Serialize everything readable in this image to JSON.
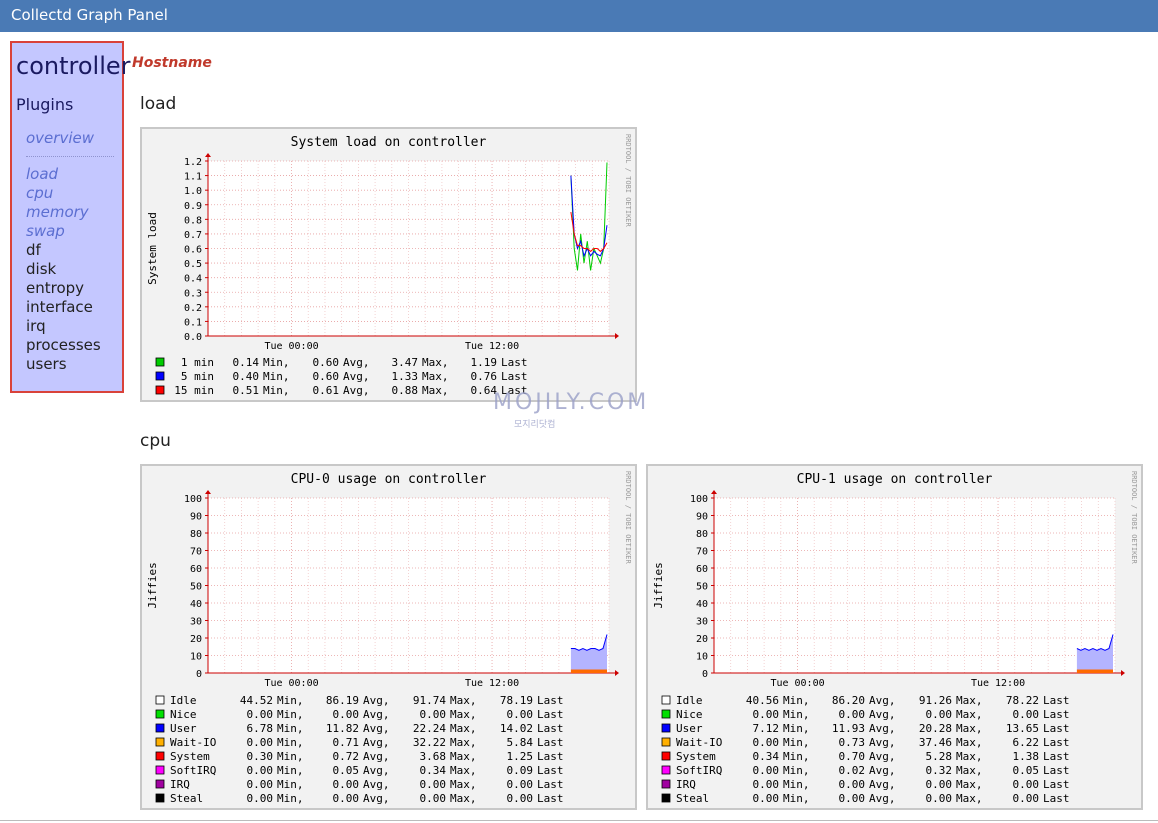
{
  "app": {
    "title": "Collectd Graph Panel"
  },
  "sidebar": {
    "host": "controller",
    "plugins_heading": "Plugins",
    "overview": "overview",
    "links": [
      "load",
      "cpu",
      "memory",
      "swap"
    ],
    "items": [
      "df",
      "disk",
      "entropy",
      "interface",
      "irq",
      "processes",
      "users"
    ]
  },
  "main": {
    "hostname_label": "Hostname",
    "sections": {
      "load": "load",
      "cpu": "cpu"
    }
  },
  "watermark": {
    "text": "MOJILY.COM",
    "sub": "모지리닷컴"
  },
  "colors": {
    "topbar": "#4a7ab5",
    "sidebar": "#c4c7ff",
    "highlight_border": "#d9423a",
    "hostname": "#c0392b"
  },
  "graphs": [
    {
      "id": "load",
      "title": "System load on controller",
      "ylabel": "System load",
      "side_label": "RRDTOOL / TOBI OETIKER",
      "x_ticks": [
        "Tue 00:00",
        "Tue 12:00"
      ],
      "y_ticks": [
        "0.0",
        "0.1",
        "0.2",
        "0.3",
        "0.4",
        "0.5",
        "0.6",
        "0.7",
        "0.8",
        "0.9",
        "1.0",
        "1.1",
        "1.2"
      ],
      "legend": [
        {
          "name": "1 min",
          "min": "0.14",
          "avg": "0.60",
          "max": "3.47",
          "last": "1.19",
          "color": "#00cc00"
        },
        {
          "name": "5 min",
          "min": "0.40",
          "avg": "0.60",
          "max": "1.33",
          "last": "0.76",
          "color": "#0000ff"
        },
        {
          "name": "15 min",
          "min": "0.51",
          "avg": "0.61",
          "max": "0.88",
          "last": "0.64",
          "color": "#ff0000"
        }
      ]
    },
    {
      "id": "cpu0",
      "title": "CPU-0 usage on controller",
      "ylabel": "Jiffies",
      "side_label": "RRDTOOL / TOBI OETIKER",
      "x_ticks": [
        "Tue 00:00",
        "Tue 12:00"
      ],
      "y_ticks": [
        "0",
        "10",
        "20",
        "30",
        "40",
        "50",
        "60",
        "70",
        "80",
        "90",
        "100"
      ],
      "legend": [
        {
          "name": "Idle",
          "min": "44.52",
          "avg": "86.19",
          "max": "91.74",
          "last": "78.19",
          "color": "#ffffff"
        },
        {
          "name": "Nice",
          "min": "0.00",
          "avg": "0.00",
          "max": "0.00",
          "last": "0.00",
          "color": "#00e000"
        },
        {
          "name": "User",
          "min": "6.78",
          "avg": "11.82",
          "max": "22.24",
          "last": "14.02",
          "color": "#0000ff"
        },
        {
          "name": "Wait-IO",
          "min": "0.00",
          "avg": "0.71",
          "max": "32.22",
          "last": "5.84",
          "color": "#ffb000"
        },
        {
          "name": "System",
          "min": "0.30",
          "avg": "0.72",
          "max": "3.68",
          "last": "1.25",
          "color": "#ff0000"
        },
        {
          "name": "SoftIRQ",
          "min": "0.00",
          "avg": "0.05",
          "max": "0.34",
          "last": "0.09",
          "color": "#ff00ff"
        },
        {
          "name": "IRQ",
          "min": "0.00",
          "avg": "0.00",
          "max": "0.00",
          "last": "0.00",
          "color": "#a000a0"
        },
        {
          "name": "Steal",
          "min": "0.00",
          "avg": "0.00",
          "max": "0.00",
          "last": "0.00",
          "color": "#000000"
        }
      ]
    },
    {
      "id": "cpu1",
      "title": "CPU-1 usage on controller",
      "ylabel": "Jiffies",
      "side_label": "RRDTOOL / TOBI OETIKER",
      "x_ticks": [
        "Tue 00:00",
        "Tue 12:00"
      ],
      "y_ticks": [
        "0",
        "10",
        "20",
        "30",
        "40",
        "50",
        "60",
        "70",
        "80",
        "90",
        "100"
      ],
      "legend": [
        {
          "name": "Idle",
          "min": "40.56",
          "avg": "86.20",
          "max": "91.26",
          "last": "78.22",
          "color": "#ffffff"
        },
        {
          "name": "Nice",
          "min": "0.00",
          "avg": "0.00",
          "max": "0.00",
          "last": "0.00",
          "color": "#00e000"
        },
        {
          "name": "User",
          "min": "7.12",
          "avg": "11.93",
          "max": "20.28",
          "last": "13.65",
          "color": "#0000ff"
        },
        {
          "name": "Wait-IO",
          "min": "0.00",
          "avg": "0.73",
          "max": "37.46",
          "last": "6.22",
          "color": "#ffb000"
        },
        {
          "name": "System",
          "min": "0.34",
          "avg": "0.70",
          "max": "5.28",
          "last": "1.38",
          "color": "#ff0000"
        },
        {
          "name": "SoftIRQ",
          "min": "0.00",
          "avg": "0.02",
          "max": "0.32",
          "last": "0.05",
          "color": "#ff00ff"
        },
        {
          "name": "IRQ",
          "min": "0.00",
          "avg": "0.00",
          "max": "0.00",
          "last": "0.00",
          "color": "#a000a0"
        },
        {
          "name": "Steal",
          "min": "0.00",
          "avg": "0.00",
          "max": "0.00",
          "last": "0.00",
          "color": "#000000"
        }
      ]
    }
  ],
  "chart_data": [
    {
      "type": "line",
      "title": "System load on controller",
      "ylabel": "System load",
      "ylim": [
        0,
        1.2
      ],
      "x_ticks": [
        "Tue 00:00",
        "Tue 12:00"
      ],
      "series": [
        {
          "name": "1 min",
          "values": [
            1.1,
            0.6,
            0.45,
            0.7,
            0.5,
            0.65,
            0.45,
            0.6,
            0.55,
            0.5,
            0.6,
            1.19
          ]
        },
        {
          "name": "5 min",
          "values": [
            1.1,
            0.7,
            0.6,
            0.65,
            0.55,
            0.6,
            0.55,
            0.58,
            0.56,
            0.55,
            0.6,
            0.76
          ]
        },
        {
          "name": "15 min",
          "values": [
            0.85,
            0.7,
            0.62,
            0.62,
            0.6,
            0.6,
            0.58,
            0.6,
            0.6,
            0.58,
            0.6,
            0.64
          ]
        }
      ]
    },
    {
      "type": "area",
      "title": "CPU-0 usage on controller",
      "ylabel": "Jiffies",
      "ylim": [
        0,
        100
      ],
      "x_ticks": [
        "Tue 00:00",
        "Tue 12:00"
      ],
      "series": [
        {
          "name": "User",
          "values": [
            13,
            13,
            12,
            13,
            12,
            13,
            13,
            12,
            13,
            21
          ]
        },
        {
          "name": "System",
          "values": [
            1,
            1,
            1,
            1,
            1,
            1,
            1,
            1,
            1,
            1
          ]
        }
      ]
    },
    {
      "type": "area",
      "title": "CPU-1 usage on controller",
      "ylabel": "Jiffies",
      "ylim": [
        0,
        100
      ],
      "x_ticks": [
        "Tue 00:00",
        "Tue 12:00"
      ],
      "series": [
        {
          "name": "User",
          "values": [
            13,
            12,
            13,
            12,
            13,
            12,
            13,
            12,
            13,
            21
          ]
        },
        {
          "name": "System",
          "values": [
            1,
            1,
            1,
            1,
            1,
            1,
            1,
            1,
            1,
            1
          ]
        }
      ]
    }
  ]
}
